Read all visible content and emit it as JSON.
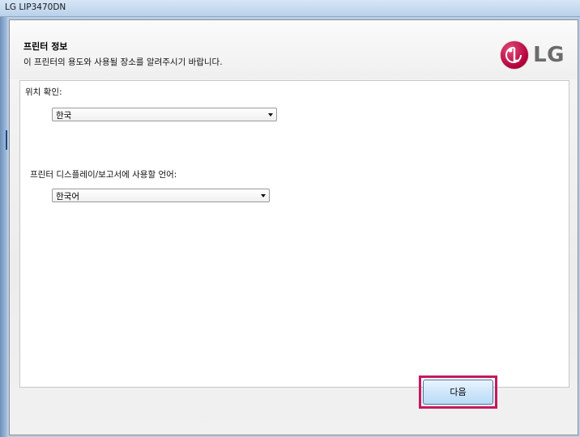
{
  "window": {
    "title": "LG LIP3470DN"
  },
  "header": {
    "title": "프린터 정보",
    "subtitle": "이 프린터의 용도와 사용될 장소를 알려주시기 바랍니다.",
    "logo_text": "LG",
    "logo_icon": "lg-logo-icon"
  },
  "location": {
    "label": "위치 확인:",
    "selected": "한국"
  },
  "language": {
    "label": "프린터 디스플레이/보고서에 사용할 언어:",
    "selected": "한국어"
  },
  "footer": {
    "next_label": "다음"
  },
  "colors": {
    "highlight_border": "#c5195f",
    "logo_red": "#b0003a",
    "titlebar": "#c8dcf0"
  }
}
